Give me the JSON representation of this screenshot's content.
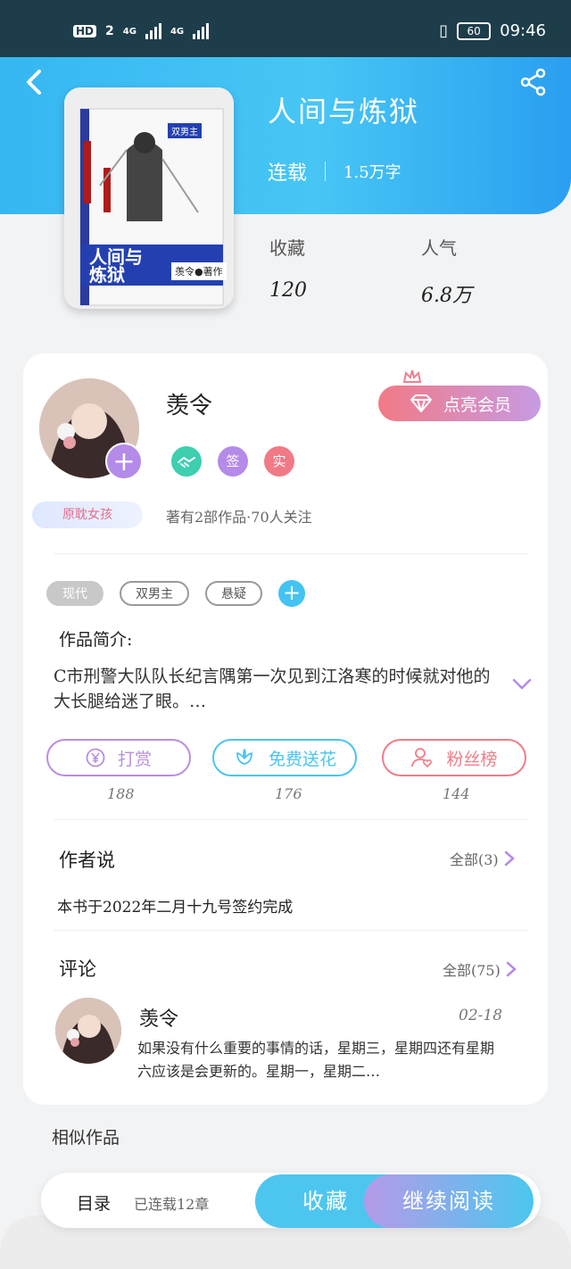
{
  "status_bar": {
    "hd": "HD",
    "sim_badge": "2",
    "net1": "4G",
    "net2": "4G",
    "battery": "60",
    "time": "09:46"
  },
  "book": {
    "title": "人间与炼狱",
    "serial_status": "连载",
    "word_count": "1.5万字",
    "favorites_label": "收藏",
    "favorites_value": "120",
    "popularity_label": "人气",
    "popularity_value": "6.8万"
  },
  "cover": {
    "badge": "双男主",
    "title_line1": "人间与",
    "title_line2": "炼狱",
    "author": "羡令●著作"
  },
  "author": {
    "name": "羡令",
    "icon_badges": [
      "签",
      "实"
    ],
    "tag": "原耽女孩",
    "meta": "著有2部作品·70人关注",
    "vip_button": "点亮会员"
  },
  "tags": [
    "现代",
    "双男主",
    "悬疑"
  ],
  "intro": {
    "label": "作品简介:",
    "text": "C市刑警大队队长纪言隅第一次见到江洛寒的时候就对他的大长腿给迷了眼。…"
  },
  "actions": [
    {
      "label": "打赏",
      "count": "188",
      "color": "#b98ee0"
    },
    {
      "label": "免费送花",
      "count": "176",
      "color": "#4cc4ef"
    },
    {
      "label": "粉丝榜",
      "count": "144",
      "color": "#ef7d87"
    }
  ],
  "author_note": {
    "title": "作者说",
    "more": "全部(3)",
    "text": "本书于2022年二月十九号签约完成"
  },
  "comments": {
    "title": "评论",
    "more": "全部(75)",
    "item": {
      "name": "羡令",
      "date": "02-18",
      "text": "如果没有什么重要的事情的话，星期三，星期四还有星期六应该是会更新的。星期一，星期二…"
    }
  },
  "similar": {
    "title": "相似作品"
  },
  "bottom_bar": {
    "toc": "目录",
    "toc_sub": "已连载12章",
    "collect": "收藏",
    "read": "继续阅读"
  },
  "colors": {
    "header_blue": "#36b7f2",
    "vip_pink": "#f27a86",
    "purple": "#b48be8",
    "teal": "#3ecfb0"
  }
}
